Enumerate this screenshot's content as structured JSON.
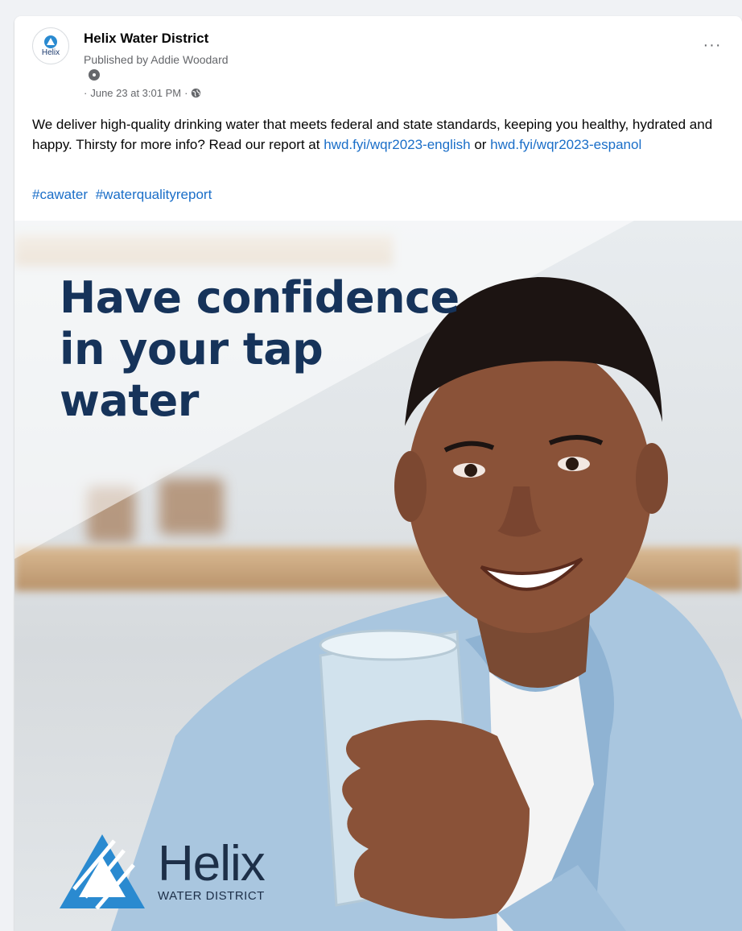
{
  "post": {
    "page_name": "Helix Water District",
    "published_by": "Published by Addie Woodard",
    "timestamp": "June 23 at 3:01 PM",
    "meta_prefix": "·",
    "meta_sep": "·",
    "avatar_text": "Helix",
    "more_label": "···",
    "body": {
      "text_1": "We deliver high-quality drinking water that meets federal and state standards, keeping you healthy, hydrated and happy. Thirsty for more info? Read our report at ",
      "link_1": "hwd.fyi/wqr2023-english",
      "text_2": " or ",
      "link_2": "hwd.fyi/wqr2023-espanol"
    },
    "hashtags": [
      "#cawater",
      "#waterqualityreport"
    ]
  },
  "image": {
    "headline_lines": [
      "Have confidence",
      "in your tap",
      "water"
    ],
    "brand_name": "Helix",
    "brand_sub": "WATER DISTRICT"
  },
  "colors": {
    "link": "#1a6ec8",
    "headline": "#16335a",
    "brand_blue": "#2a8ad0"
  },
  "icons": {
    "location": "location-pin-icon",
    "globe": "globe-icon",
    "more": "more-options-icon"
  }
}
